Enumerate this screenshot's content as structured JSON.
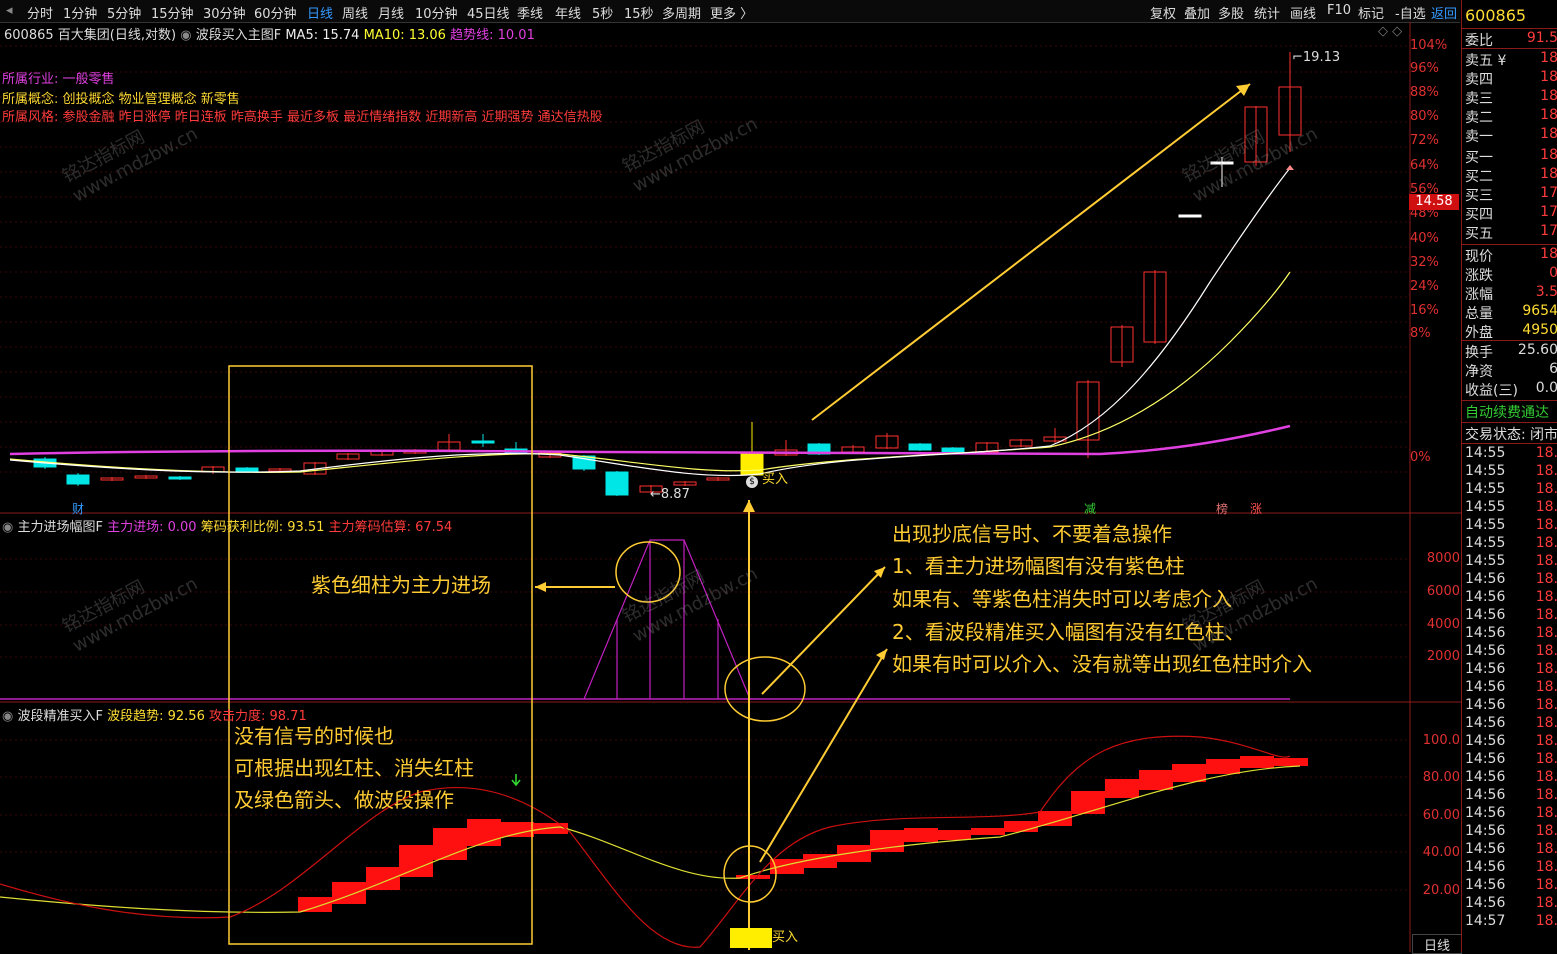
{
  "toolbar": {
    "periods": [
      "分时",
      "1分钟",
      "5分钟",
      "15分钟",
      "30分钟",
      "60分钟",
      "日线",
      "周线",
      "月线",
      "10分钟",
      "45日线",
      "季线",
      "年线",
      "5秒",
      "15秒",
      "多周期",
      "更多 〉"
    ],
    "active_period": "日线",
    "tools": [
      "复权",
      "叠加",
      "多股",
      "统计",
      "画线",
      "F10",
      "标记",
      "-自选",
      "返回"
    ]
  },
  "main_chart": {
    "code": "600865",
    "name": "百大集团",
    "mode": "(日线,对数)",
    "indicator_name": "波段买入主图F",
    "ma5_label": "MA5: 15.74",
    "ma10_label": "MA10: 13.06",
    "trend_label": "趋势线: 10.01",
    "industry_label": "所属行业:",
    "industry_value": "一般零售",
    "concept_label": "所属概念:",
    "concept_value": "创投概念 物业管理概念 新零售",
    "style_label": "所属风格:",
    "style_value": "参股金融 昨日涨停 昨日连板 昨高换手 最近多板 最近情绪指数 近期新高 近期强势 通达信热股",
    "high_label": "19.13",
    "low_label": "8.87",
    "buy_label": "买入",
    "price_tag": "14.58",
    "event_labels": [
      "财",
      "减",
      "榜",
      "涨"
    ],
    "axis": [
      "104%",
      "96%",
      "88%",
      "80%",
      "72%",
      "64%",
      "56%",
      "48%",
      "40%",
      "32%",
      "24%",
      "16%",
      "8%",
      "0%"
    ]
  },
  "chart_data": [
    {
      "type": "candlestick",
      "title": "波段买入主图F",
      "ylabel": "%",
      "y_ticks": [
        "104%",
        "96%",
        "88%",
        "80%",
        "72%",
        "64%",
        "56%",
        "48%",
        "40%",
        "32%",
        "24%",
        "16%",
        "8%",
        "0%"
      ],
      "series": [
        {
          "name": "MA5",
          "last": 15.74
        },
        {
          "name": "MA10",
          "last": 13.06
        },
        {
          "name": "趋势线",
          "last": 10.01
        }
      ],
      "high": 19.13,
      "low": 8.87
    },
    {
      "type": "bar",
      "title": "主力进场幅图F",
      "y_ticks": [
        8000,
        6000,
        4000,
        2000
      ],
      "series": [
        {
          "name": "主力进场",
          "last": 0.0
        },
        {
          "name": "筹码获利比例",
          "last": 93.51
        },
        {
          "name": "主力筹码估算",
          "last": 67.54
        }
      ]
    },
    {
      "type": "bar",
      "title": "波段精准买入F",
      "y_ticks": [
        100.0,
        80.0,
        60.0,
        40.0,
        20.0
      ],
      "series": [
        {
          "name": "波段趋势",
          "last": 92.56
        },
        {
          "name": "攻击力度",
          "last": 98.71
        }
      ]
    }
  ],
  "panel2": {
    "name": "主力进场幅图F",
    "l1": "主力进场: 0.00",
    "l2": "筹码获利比例: 93.51",
    "l3": "主力筹码估算: 67.54",
    "axis": [
      "8000",
      "6000",
      "4000",
      "2000"
    ]
  },
  "panel3": {
    "name": "波段精准买入F",
    "l1": "波段趋势: 92.56",
    "l2": "攻击力度: 98.71",
    "axis": [
      "100.0",
      "80.00",
      "60.00",
      "40.00",
      "20.00"
    ],
    "buy_label": "买入",
    "bottom_tab": "日线"
  },
  "notes": {
    "purple": "紫色细柱为主力进场",
    "no_signal_1": "没有信号的时候也",
    "no_signal_2": "可根据出现红柱、消失红柱",
    "no_signal_3": "及绿色箭头、做波段操作",
    "tip_1": "出现抄底信号时、不要着急操作",
    "tip_2": "1、看主力进场幅图有没有紫色柱",
    "tip_3": "如果有、等紫色柱消失时可以考虑介入",
    "tip_4": "2、看波段精准买入幅图有没有红色柱、",
    "tip_5": "如果有时可以介入、没有就等出现红色柱时介入"
  },
  "watermark": {
    "line1": "铭达指标网",
    "line2": "www.mdzbw.cn"
  },
  "quote": {
    "code": "600865",
    "weibi_label": "委比",
    "weibi_value": "91.5",
    "asks": [
      [
        "卖五 ¥",
        "18"
      ],
      [
        "卖四",
        "18"
      ],
      [
        "卖三",
        "18"
      ],
      [
        "卖二",
        "18"
      ],
      [
        "卖一",
        "18"
      ]
    ],
    "bids": [
      [
        "买一",
        "18"
      ],
      [
        "买二",
        "18"
      ],
      [
        "买三",
        "17"
      ],
      [
        "买四",
        "17"
      ],
      [
        "买五",
        "17"
      ]
    ],
    "stats": [
      [
        "现价",
        "18"
      ],
      [
        "涨跌",
        "0"
      ],
      [
        "涨幅",
        "3.5"
      ],
      [
        "总量",
        "9654"
      ],
      [
        "外盘",
        "4950"
      ]
    ],
    "stats2": [
      [
        "换手",
        "25.60"
      ],
      [
        "净资",
        "6"
      ],
      [
        "收益(三)",
        "0.0"
      ]
    ],
    "auto_fee": "自动续费通达",
    "trade_status_label": "交易状态:",
    "trade_status_value": "闭市",
    "ticks": [
      [
        "14:55",
        "18."
      ],
      [
        "14:55",
        "18."
      ],
      [
        "14:55",
        "18."
      ],
      [
        "14:55",
        "18."
      ],
      [
        "14:55",
        "18."
      ],
      [
        "14:55",
        "18."
      ],
      [
        "14:55",
        "18."
      ],
      [
        "14:56",
        "18."
      ],
      [
        "14:56",
        "18."
      ],
      [
        "14:56",
        "18."
      ],
      [
        "14:56",
        "18."
      ],
      [
        "14:56",
        "18."
      ],
      [
        "14:56",
        "18."
      ],
      [
        "14:56",
        "18."
      ],
      [
        "14:56",
        "18."
      ],
      [
        "14:56",
        "18."
      ],
      [
        "14:56",
        "18."
      ],
      [
        "14:56",
        "18."
      ],
      [
        "14:56",
        "18."
      ],
      [
        "14:56",
        "18."
      ],
      [
        "14:56",
        "18."
      ],
      [
        "14:56",
        "18."
      ],
      [
        "14:56",
        "18."
      ],
      [
        "14:56",
        "18."
      ],
      [
        "14:56",
        "18."
      ],
      [
        "14:56",
        "18."
      ],
      [
        "14:57",
        "18."
      ]
    ]
  }
}
